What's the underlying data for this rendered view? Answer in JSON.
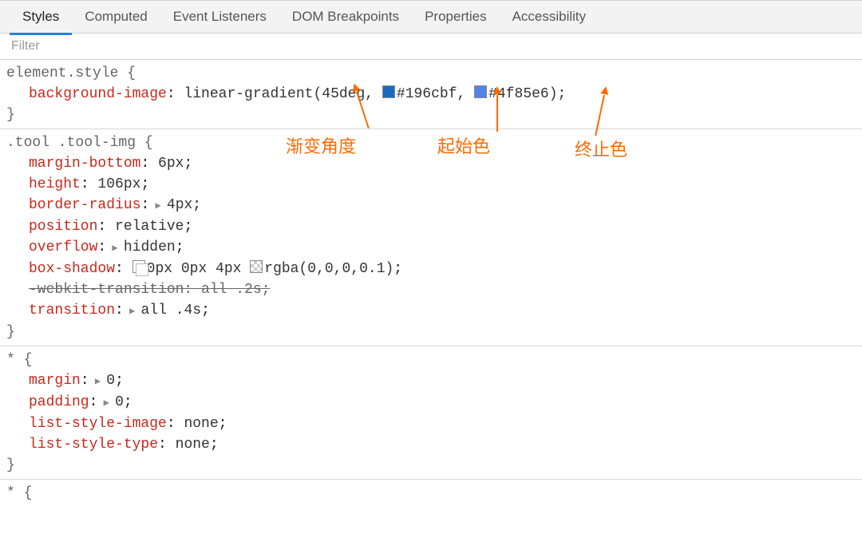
{
  "tabs": [
    "Styles",
    "Computed",
    "Event Listeners",
    "DOM Breakpoints",
    "Properties",
    "Accessibility"
  ],
  "filterPlaceholder": "Filter",
  "rule1": {
    "selector": "element.style",
    "prop": "background-image",
    "func": "linear-gradient(",
    "arg1": "45deg",
    "sep1": ", ",
    "color1": "#196cbf",
    "sep2": ", ",
    "color2": "#4f85e6",
    "close": ");"
  },
  "rule2": {
    "selector": ".tool .tool-img",
    "d1p": "margin-bottom",
    "d1v": "6px",
    "d2p": "height",
    "d2v": "106px",
    "d3p": "border-radius",
    "d3v": "4px",
    "d4p": "position",
    "d4v": "relative",
    "d5p": "overflow",
    "d5v": "hidden",
    "d6p": "box-shadow",
    "d6v": "0px 0px 4px ",
    "d6rgba": "rgba(0,0,0,0.1)",
    "d7full": "-webkit-transition: all .2s;",
    "d8p": "transition",
    "d8v": "all .4s"
  },
  "rule3": {
    "selector": "*",
    "d1p": "margin",
    "d1v": "0",
    "d2p": "padding",
    "d2v": "0",
    "d3p": "list-style-image",
    "d3v": "none",
    "d4p": "list-style-type",
    "d4v": "none"
  },
  "rule4": {
    "selector": "*"
  },
  "ann1": "渐变角度",
  "ann2": "起始色",
  "ann3": "终止色"
}
